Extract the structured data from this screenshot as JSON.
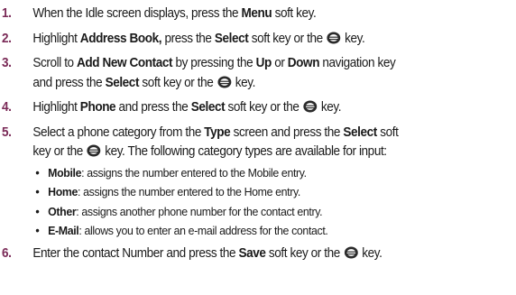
{
  "steps": [
    {
      "number": "1.",
      "parts": [
        "When the Idle screen displays, press the ",
        "Menu",
        " soft key."
      ]
    },
    {
      "number": "2.",
      "parts": [
        "Highlight ",
        "Address Book,",
        " press the ",
        "Select",
        " soft key or the ",
        " key."
      ]
    },
    {
      "number": "3.",
      "line1": [
        "Scroll to ",
        "Add New Contact",
        " by pressing the ",
        "Up",
        " or ",
        "Down",
        " navigation key"
      ],
      "line2": [
        "and press the ",
        "Select",
        " soft key or the ",
        " key."
      ]
    },
    {
      "number": "4.",
      "parts": [
        "Highlight ",
        "Phone",
        " and press the ",
        "Select",
        " soft key or the ",
        " key."
      ]
    },
    {
      "number": "5.",
      "line1": [
        "Select a phone category from the ",
        "Type",
        " screen and press the ",
        "Select",
        " soft"
      ],
      "line2": "key or the ",
      "line2b": " key. The following category types are available for input:",
      "bullets": [
        {
          "term": "Mobile",
          "desc": ": assigns the number entered to the Mobile entry."
        },
        {
          "term": "Home",
          "desc": ": assigns the number entered to the Home entry."
        },
        {
          "term": "Other",
          "desc": ": assigns another phone number for the contact entry."
        },
        {
          "term": "E-Mail",
          "desc": ": allows you to enter an e-mail address for the contact."
        }
      ]
    },
    {
      "number": "6.",
      "parts": [
        "Enter the contact Number and press the ",
        "Save",
        " soft key or the ",
        " key."
      ]
    }
  ],
  "bullet_glyph": "•",
  "icons": {
    "ok_key": "ok-key-icon"
  },
  "colors": {
    "step_number": "#7a2a57",
    "text": "#1a1a1a"
  }
}
